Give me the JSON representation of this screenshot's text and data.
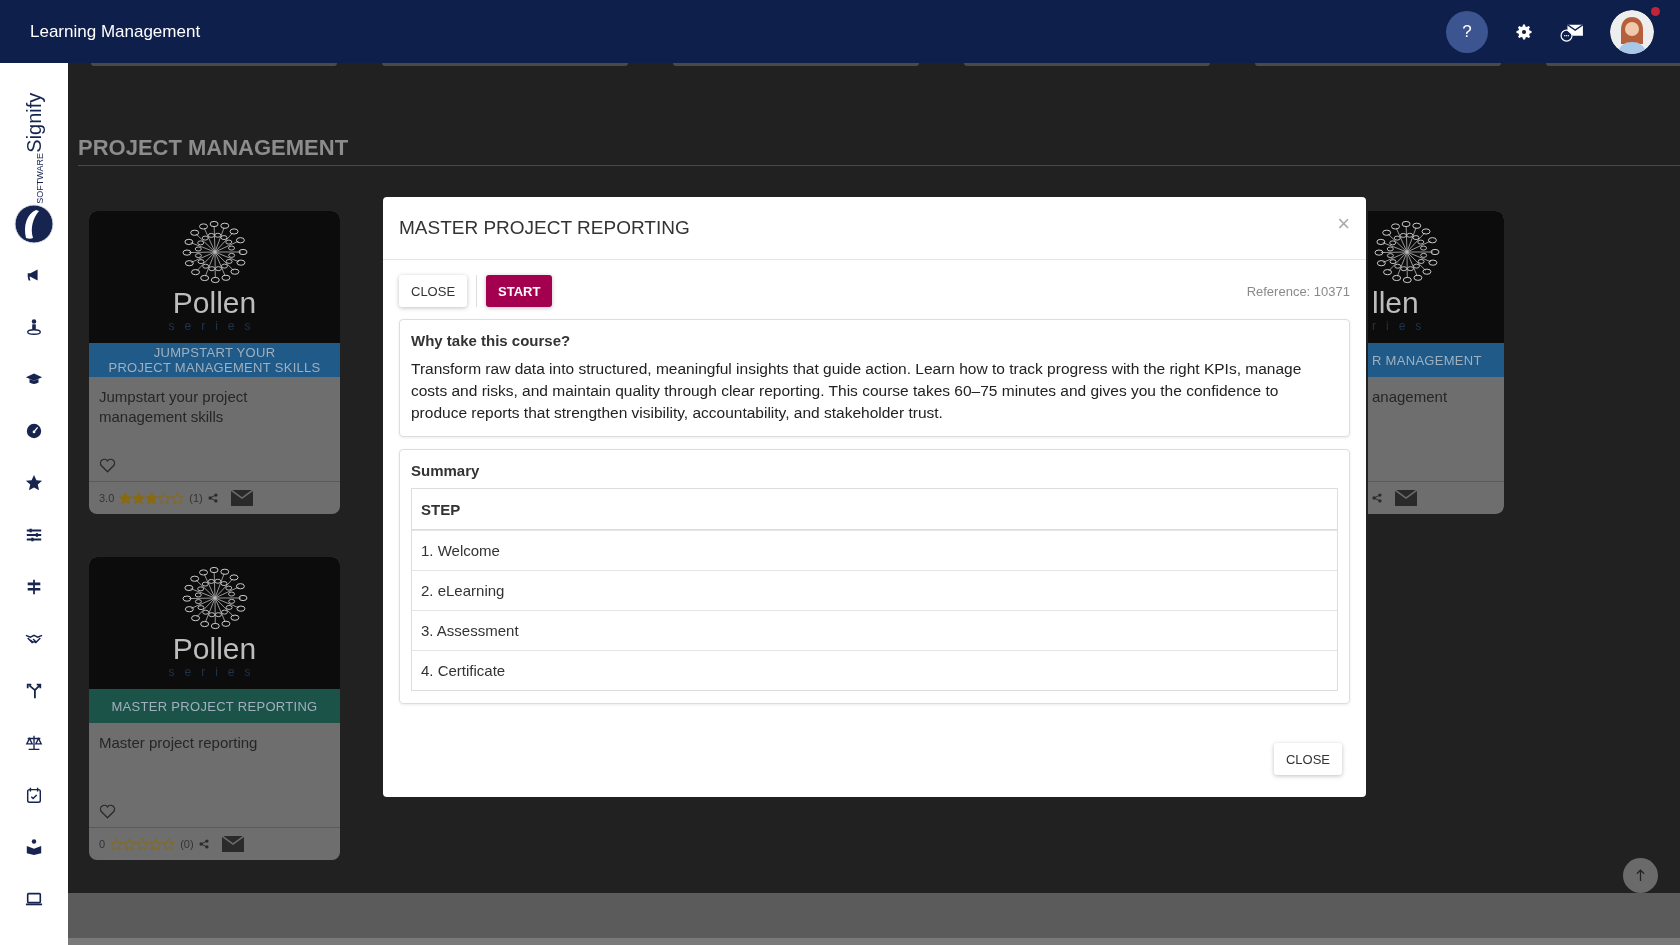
{
  "app": {
    "title": "Learning Management"
  },
  "header_actions": {
    "help": "?",
    "has_notification": true
  },
  "sidebar": {
    "logo": {
      "name": "Signify",
      "sub": "SOFTWARE"
    }
  },
  "section": {
    "title": "PROJECT MANAGEMENT"
  },
  "cards": [
    {
      "kind": "full",
      "wordmark": "Pollen",
      "tagline": "series",
      "banner_lines": [
        "JUMPSTART YOUR",
        "PROJECT MANAGEMENT SKILLS"
      ],
      "color": "#1f5a88",
      "title": "Jumpstart your project management skills",
      "favorite": false,
      "rating": "3.0",
      "stars": 3,
      "count": "(1)"
    },
    {
      "kind": "partial",
      "wordmark": "llen",
      "tagline": "ries",
      "banner_lines": [
        "R MANAGEMENT"
      ],
      "color": "#1f5a88",
      "title": "anagement"
    },
    {
      "kind": "full",
      "wordmark": "Pollen",
      "tagline": "series",
      "banner_lines": [
        "MASTER PROJECT REPORTING"
      ],
      "color": "#1c5349",
      "title": "Master project reporting",
      "favorite": false,
      "rating": "0",
      "stars": 0,
      "count": "(0)"
    }
  ],
  "modal": {
    "title": "MASTER PROJECT REPORTING",
    "close_symbol": "×",
    "toolbar": {
      "close": "CLOSE",
      "start": "START",
      "reference": "Reference: 10371"
    },
    "why": {
      "heading": "Why take this course?",
      "text": "Transform raw data into structured, meaningful insights that guide action. Learn how to track progress with the right KPIs, manage costs and risks, and maintain quality through clear reporting. This course takes 60–75 minutes and gives you the confidence to produce reports that strengthen visibility, accountability, and stakeholder trust."
    },
    "summary": {
      "heading": "Summary",
      "column": "STEP",
      "rows": [
        "1. Welcome",
        "2. eLearning",
        "3. Assessment",
        "4. Certificate"
      ]
    },
    "footer_button": "CLOSE"
  }
}
